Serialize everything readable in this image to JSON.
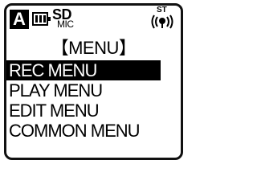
{
  "status_bar": {
    "mode": "A",
    "battery_icon": "battery-icon",
    "battery_level": 3,
    "media": "SD",
    "input": "MIC",
    "stereo_label": "ST",
    "stereo_icon": "stereo-mic-icon"
  },
  "menu": {
    "title": "【MENU】",
    "items": [
      {
        "label": "REC MENU",
        "selected": true
      },
      {
        "label": "PLAY MENU",
        "selected": false
      },
      {
        "label": "EDIT MENU",
        "selected": false
      },
      {
        "label": "COMMON MENU",
        "selected": false
      }
    ]
  },
  "colors": {
    "foreground": "#000000",
    "background": "#ffffff",
    "highlight": "#000000",
    "highlight_text": "#ffffff"
  }
}
